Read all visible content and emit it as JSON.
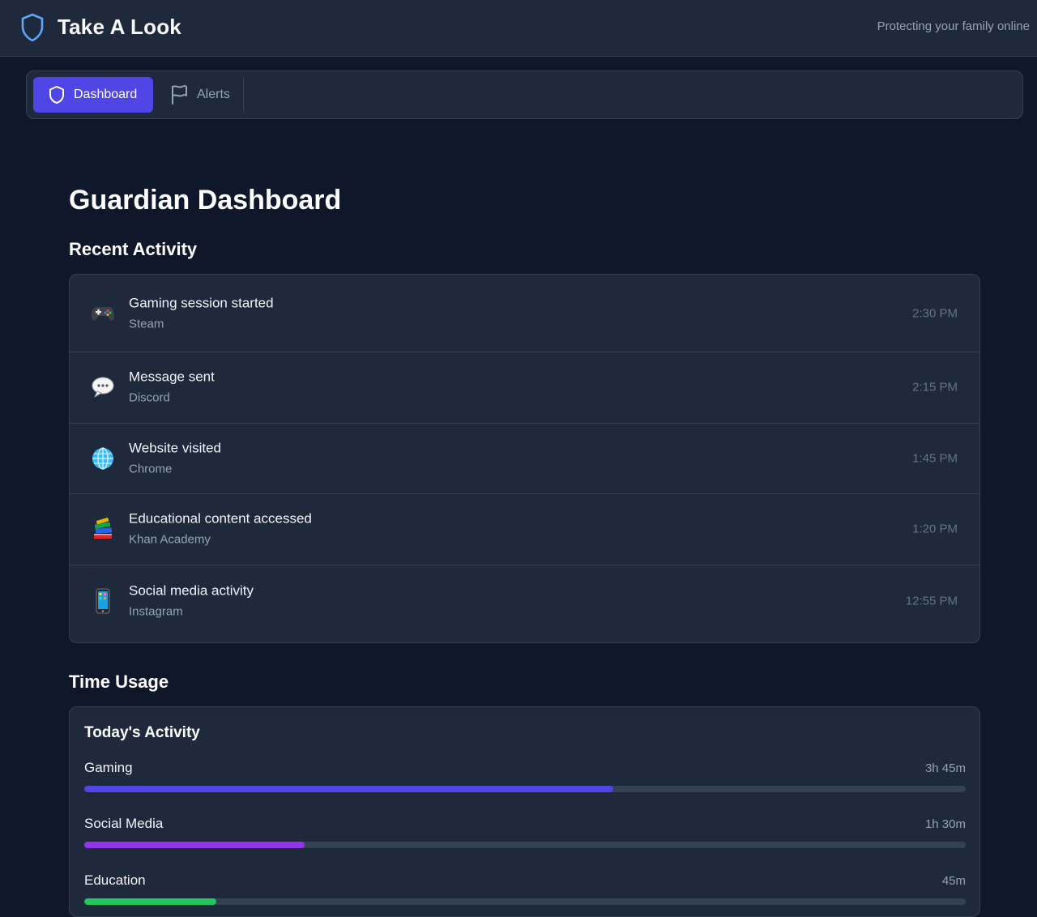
{
  "header": {
    "app_name": "Take A Look",
    "tagline": "Protecting your family online",
    "logo_icon": "shield-icon",
    "accent": "#60a5fa"
  },
  "tabs": [
    {
      "label": "Dashboard",
      "icon": "shield-icon",
      "active": true
    },
    {
      "label": "Alerts",
      "icon": "flag-icon",
      "active": false
    }
  ],
  "main": {
    "title": "Guardian Dashboard",
    "recent_activity": {
      "heading": "Recent Activity",
      "items": [
        {
          "icon": "gamepad-icon",
          "title": "Gaming session started",
          "source": "Steam",
          "time": "2:30 PM"
        },
        {
          "icon": "speech-bubble-icon",
          "title": "Message sent",
          "source": "Discord",
          "time": "2:15 PM"
        },
        {
          "icon": "globe-icon",
          "title": "Website visited",
          "source": "Chrome",
          "time": "1:45 PM"
        },
        {
          "icon": "books-icon",
          "title": "Educational content accessed",
          "source": "Khan Academy",
          "time": "1:20 PM"
        },
        {
          "icon": "phone-icon",
          "title": "Social media activity",
          "source": "Instagram",
          "time": "12:55 PM"
        }
      ]
    },
    "time_usage": {
      "heading": "Time Usage",
      "card_title": "Today's Activity",
      "items": [
        {
          "label": "Gaming",
          "value": "3h 45m",
          "fraction": 0.6,
          "color": "#4f46e5"
        },
        {
          "label": "Social Media",
          "value": "1h 30m",
          "fraction": 0.25,
          "color": "#9333ea"
        },
        {
          "label": "Education",
          "value": "45m",
          "fraction": 0.15,
          "color": "#22c55e"
        }
      ]
    }
  }
}
